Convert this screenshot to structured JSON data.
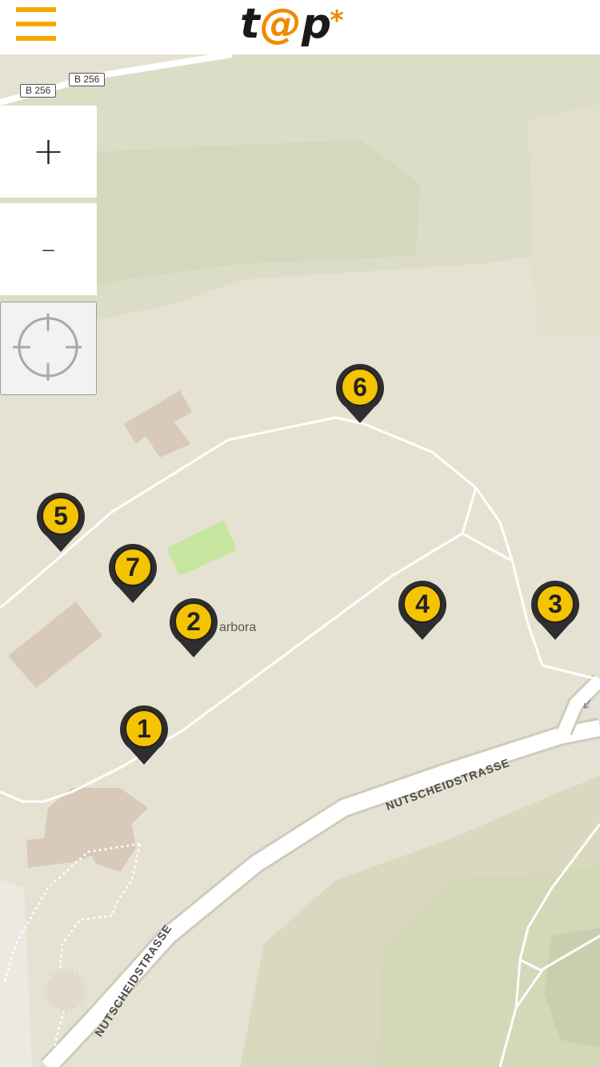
{
  "header": {
    "menu_icon": "hamburger-icon",
    "logo": {
      "t": "t",
      "at": "@",
      "p": "p",
      "star": "*"
    }
  },
  "colors": {
    "accent": "#f7a800",
    "logo_orange": "#f08a00",
    "marker_yellow": "#f5c400",
    "marker_dark": "#2e2e2e",
    "map_base": "#e6e2d3",
    "forest": "#d5d9bd",
    "road": "#ffffff",
    "building": "#d8c8b8",
    "grass": "#c4e39a"
  },
  "controls": {
    "zoom_in": "+",
    "zoom_out": "–",
    "locate_icon": "crosshair-icon"
  },
  "map": {
    "road_shields": [
      "B 256",
      "B 256"
    ],
    "place_label": "arbora",
    "street_labels": [
      "NUTSCHEIDSTRASSE",
      "NUTSCHEIDSTRASSE"
    ],
    "markers": [
      {
        "label": "1"
      },
      {
        "label": "2"
      },
      {
        "label": "3"
      },
      {
        "label": "4"
      },
      {
        "label": "5"
      },
      {
        "label": "6"
      },
      {
        "label": "7"
      }
    ]
  }
}
